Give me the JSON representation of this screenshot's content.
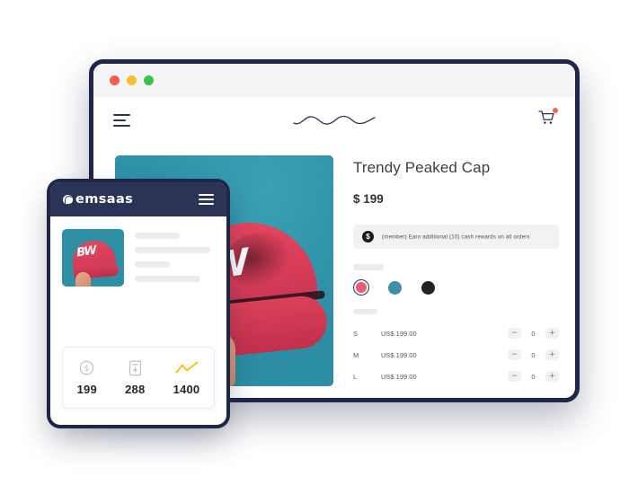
{
  "theme": {
    "navy": "#1e2748",
    "topbar_navy": "#2b3356",
    "teal": "#2e8fa5",
    "pink": "#ef5d72",
    "black_swatch": "#232323",
    "yellow": "#f5c21b",
    "badge_red": "#fc6148"
  },
  "browser": {
    "traffic_lights": [
      "red",
      "yellow",
      "green"
    ],
    "menu_icon": "hamburger-menu-icon",
    "logo_icon": "squiggle-wave-logo",
    "cart_icon": "shopping-cart-icon",
    "cart_has_notification": true
  },
  "product": {
    "title": "Trendy Peaked Cap",
    "price": "$ 199",
    "image_alt": "red peaked cap held by hand on teal background",
    "cap_graphic_text": "BW",
    "reward_banner": {
      "icon": "dollar-coin-icon",
      "coin_symbol": "$",
      "text": "(member) Earn additional (10) cash rewards on all orders"
    },
    "colors": [
      {
        "name": "pink",
        "hex": "#ef5d72",
        "selected": true
      },
      {
        "name": "teal",
        "hex": "#3d8fa3",
        "selected": false
      },
      {
        "name": "black",
        "hex": "#232323",
        "selected": false
      }
    ],
    "sizes": [
      {
        "size": "S",
        "price": "US$ 199.00",
        "qty": "0"
      },
      {
        "size": "M",
        "price": "US$ 199.00",
        "qty": "0"
      },
      {
        "size": "L",
        "price": "US$ 199.00",
        "qty": "0"
      }
    ],
    "stepper": {
      "decrement": "−",
      "increment": "+"
    }
  },
  "mobile": {
    "brand": "emsaas",
    "brand_mark_icon": "circle-swirl-logo-icon",
    "menu_icon": "hamburger-menu-icon",
    "thumb_alt": "red peaked cap thumbnail",
    "thumb_graphic_text": "BW",
    "stats": [
      {
        "icon": "dollar-circle-icon",
        "value": "199"
      },
      {
        "icon": "receipt-download-icon",
        "value": "288"
      },
      {
        "icon": "line-chart-up-icon",
        "value": "1400"
      }
    ]
  }
}
